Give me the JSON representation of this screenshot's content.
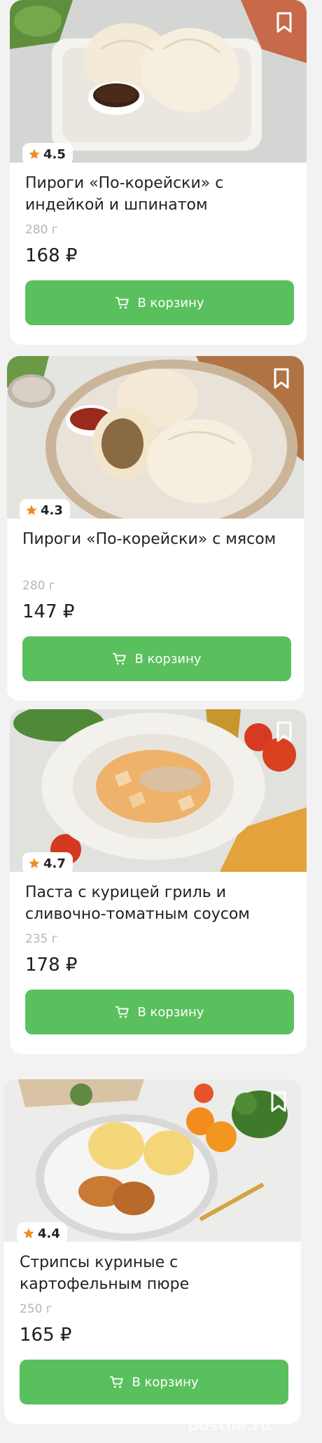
{
  "products": [
    {
      "rating": "4.5",
      "title": "Пироги «По-корейски» с индейкой и шпинатом",
      "weight": "280 г",
      "price": "168 ₽",
      "button_label": "В корзину"
    },
    {
      "rating": "4.3",
      "title": "Пироги «По-корейски» с мясом",
      "weight": "280 г",
      "price": "147 ₽",
      "button_label": "В корзину"
    },
    {
      "rating": "4.7",
      "title": "Паста с курицей гриль и сливочно-томатным соусом",
      "weight": "235 г",
      "price": "178 ₽",
      "button_label": "В корзину"
    },
    {
      "rating": "4.4",
      "title": "Стрипсы куриные с картофельным пюре",
      "weight": "250 г",
      "price": "165 ₽",
      "button_label": "В корзину"
    }
  ],
  "colors": {
    "button_green": "#5ac05e",
    "star_orange": "#f08a24",
    "weight_grey": "#b6b6b6"
  },
  "icons": {
    "bookmark": "bookmark-icon",
    "star": "star-icon",
    "cart": "cart-icon"
  }
}
